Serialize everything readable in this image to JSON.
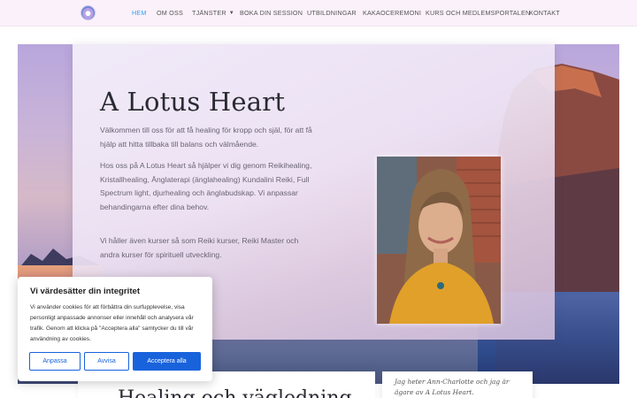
{
  "nav": {
    "items": [
      {
        "label": "HEM",
        "active": true
      },
      {
        "label": "OM OSS",
        "active": false
      },
      {
        "label": "TJÄNSTER",
        "active": false,
        "has_dropdown": true
      },
      {
        "label": "BOKA DIN SESSION",
        "active": false
      },
      {
        "label": "UTBILDNINGAR",
        "active": false
      },
      {
        "label": "KAKAOCEREMONI",
        "active": false
      },
      {
        "label": "KURS OCH MEDLEMSPORTALEN",
        "active": false
      },
      {
        "label": "KONTAKT",
        "active": false
      }
    ],
    "active_color": "#2ea3f2"
  },
  "hero": {
    "title": "A Lotus Heart",
    "intro": "Välkommen till oss för att få healing för kropp och själ, för att få hjälp att hitta tillbaka till balans och välmående.",
    "services": "Hos oss på A Lotus Heart så hjälper vi dig genom Reikihealing, Kristallhealing, Änglaterapi (änglahealing) Kundalini Reiki, Full Spectrum light, djurhealing och änglabudskap. Vi anpassar behandingarna efter dina behov.",
    "courses_partial": "Vi håller även kurser så som Reiki kurser, Reiki Master och andra kurser för spirituell utveckling.",
    "photo_caption": "Jag heter Ann-Charlotte och jag är ägare av A Lotus Heart.",
    "next_heading_partial": "Healing och vägledning"
  },
  "cookie": {
    "title": "Vi värdesätter din integritet",
    "text": "Vi använder cookies för att förbättra din surfupplevelse, visa personligt anpassade annonser eller innehåll och analysera vår trafik. Genom att klicka på \"Acceptera alla\" samtycker du till vår användning av cookies.",
    "customize": "Anpassa",
    "reject": "Avvisa",
    "accept": "Acceptera alla",
    "accent": "#1863dc"
  }
}
